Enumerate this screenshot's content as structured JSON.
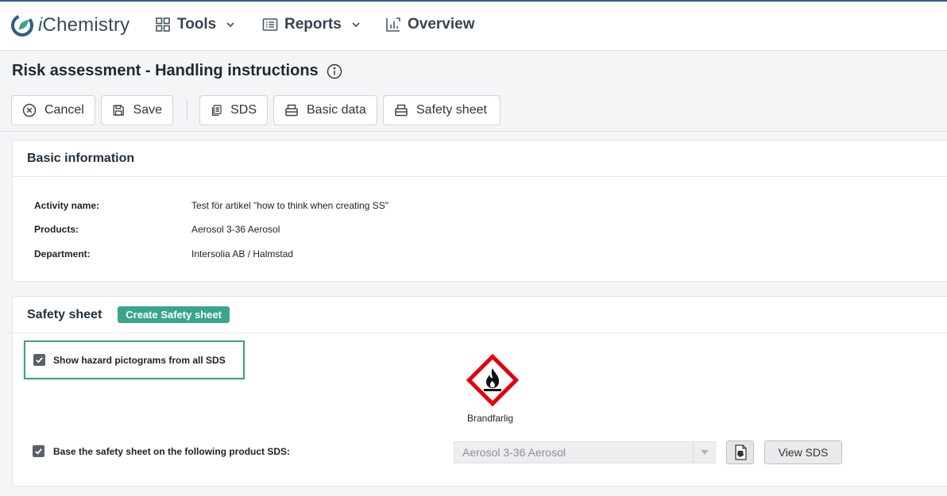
{
  "app": {
    "brand_prefix": "i",
    "brand_rest": "Chemistry"
  },
  "nav": {
    "tools": "Tools",
    "reports": "Reports",
    "overview": "Overview"
  },
  "page": {
    "title": "Risk assessment - Handling instructions"
  },
  "toolbar": {
    "cancel": "Cancel",
    "save": "Save",
    "sds": "SDS",
    "basic_data": "Basic data",
    "safety_sheet": "Safety sheet"
  },
  "basic_info": {
    "title": "Basic information",
    "rows": [
      {
        "label": "Activity name:",
        "value": "Test för artikel \"how to think when creating SS\""
      },
      {
        "label": "Products:",
        "value": "Aerosol 3-36 Aerosol"
      },
      {
        "label": "Department:",
        "value": "Intersolia AB / Halmstad"
      }
    ]
  },
  "safety_sheet": {
    "title": "Safety sheet",
    "create_label": "Create Safety sheet",
    "show_pictograms_label": "Show hazard pictograms from all SDS",
    "show_pictograms_checked": true,
    "pictogram_label": "Brandfarlig",
    "pictogram_icon": "flame-icon",
    "base_label": "Base the safety sheet on the following product SDS:",
    "base_checked": true,
    "selected_product": "Aerosol 3-36 Aerosol",
    "view_sds_label": "View SDS"
  },
  "colors": {
    "accent": "#3aa48c",
    "brand": "#2d5f86",
    "hazard_red": "#e3000f"
  }
}
